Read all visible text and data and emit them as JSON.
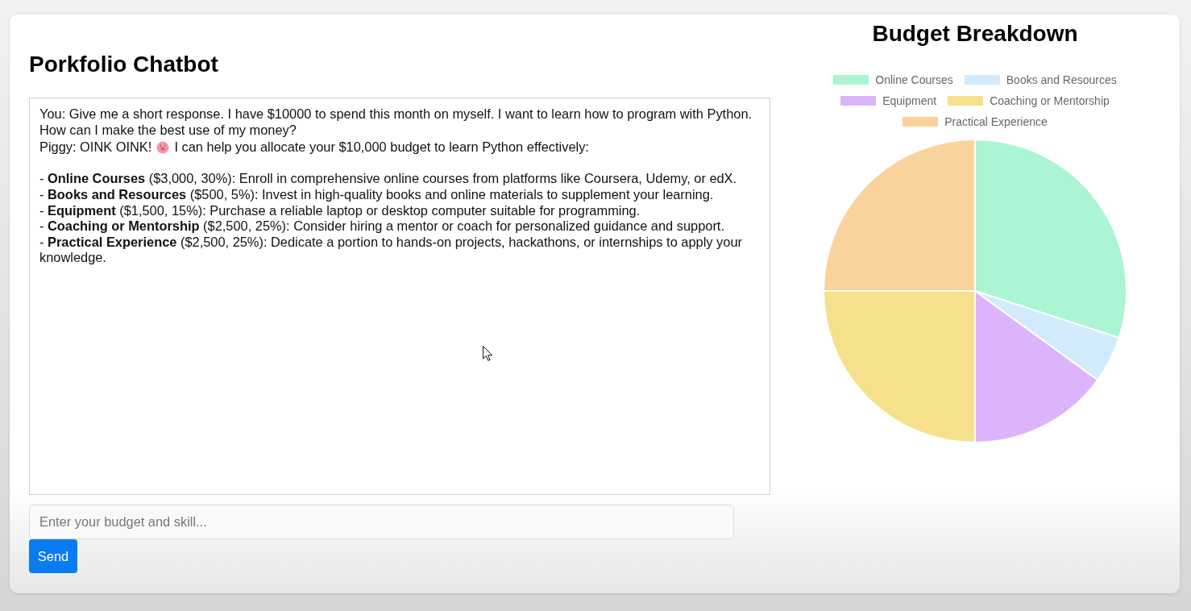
{
  "app": {
    "title": "Porkfolio Chatbot"
  },
  "chat": {
    "messages": [
      {
        "kind": "user",
        "text": "You: Give me a short response. I have $10000 to spend this month on myself. I want to learn how to program with Python. How can I make the best use of my money?"
      },
      {
        "kind": "bot",
        "greeting": "Piggy: OINK OINK!",
        "text": "I can help you allocate your $10,000 budget to learn Python effectively:",
        "items": [
          "- **Online Courses** ($3,000, 30%): Enroll in comprehensive online courses from platforms like Coursera, Udemy, or edX.",
          "- **Books and Resources** ($500, 5%): Invest in high-quality books and online materials to supplement your learning.",
          "- **Equipment** ($1,500, 15%): Purchase a reliable laptop or desktop computer suitable for programming.",
          "- **Coaching or Mentorship** ($2,500, 25%): Consider hiring a mentor or coach for personalized guidance and support.",
          "- **Practical Experience** ($2,500, 25%): Dedicate a portion to hands-on projects, hackathons, or internships to apply your knowledge."
        ]
      }
    ]
  },
  "input": {
    "placeholder": "Enter your budget and skill..."
  },
  "send_button": {
    "label": "Send"
  },
  "budget_chart": {
    "chart_data": [
      {
        "type": "pie",
        "title": "Budget Breakdown",
        "categories": [
          "Online Courses",
          "Books and Resources",
          "Equipment",
          "Coaching or Mentorship",
          "Practical Experience"
        ],
        "values": [
          30,
          5,
          15,
          25,
          25
        ],
        "colors": [
          "#abf5d3",
          "#d2ebfc",
          "#dcb4fc",
          "#f7e08c",
          "#fad29c"
        ],
        "legend": "top"
      }
    ]
  }
}
